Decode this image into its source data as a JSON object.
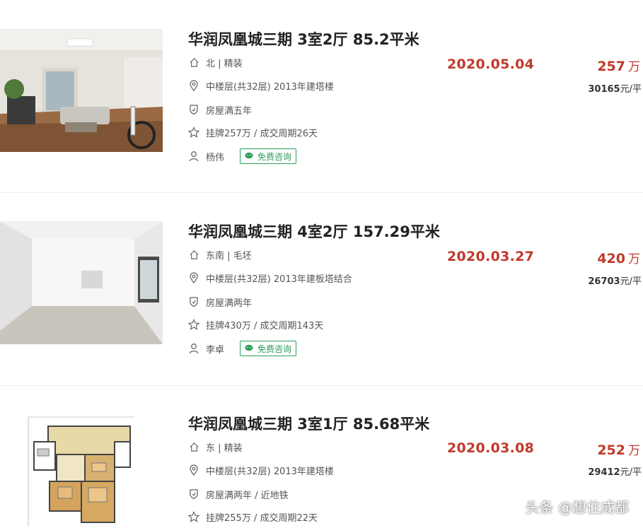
{
  "listings": [
    {
      "title": "华润凤凰城三期 3室2厅 85.2平米",
      "orientation": "北 | 精装",
      "floor": "中楼层(共32层) 2013年建塔楼",
      "tag": "房屋满五年",
      "listing_info": "挂牌257万 / 成交周期26天",
      "agent": "杨伟",
      "consult_label": "免费咨询",
      "deal_date": "2020.05.04",
      "total_price": "257",
      "total_unit": "万",
      "unit_price": "30165",
      "unit_price_suffix": "元/平"
    },
    {
      "title": "华润凤凰城三期 4室2厅 157.29平米",
      "orientation": "东南 | 毛坯",
      "floor": "中楼层(共32层) 2013年建板塔结合",
      "tag": "房屋满两年",
      "listing_info": "挂牌430万 / 成交周期143天",
      "agent": "李卓",
      "consult_label": "免费咨询",
      "deal_date": "2020.03.27",
      "total_price": "420",
      "total_unit": "万",
      "unit_price": "26703",
      "unit_price_suffix": "元/平"
    },
    {
      "title": "华润凤凰城三期 3室1厅 85.68平米",
      "orientation": "东 | 精装",
      "floor": "中楼层(共32层) 2013年建塔楼",
      "tag": "房屋满两年 / 近地铁",
      "listing_info": "挂牌255万 / 成交周期22天",
      "deal_date": "2020.03.08",
      "total_price": "252",
      "total_unit": "万",
      "unit_price": "29412",
      "unit_price_suffix": "元/平"
    }
  ],
  "watermark": "头条 @想住成都",
  "colors": {
    "accent_red": "#c0392b",
    "consult_green": "#2e9e5a",
    "divider": "#eeeeee"
  },
  "icons": [
    "house-icon",
    "location-pin-icon",
    "shield-icon",
    "star-icon",
    "person-icon",
    "wechat-chat-icon"
  ]
}
